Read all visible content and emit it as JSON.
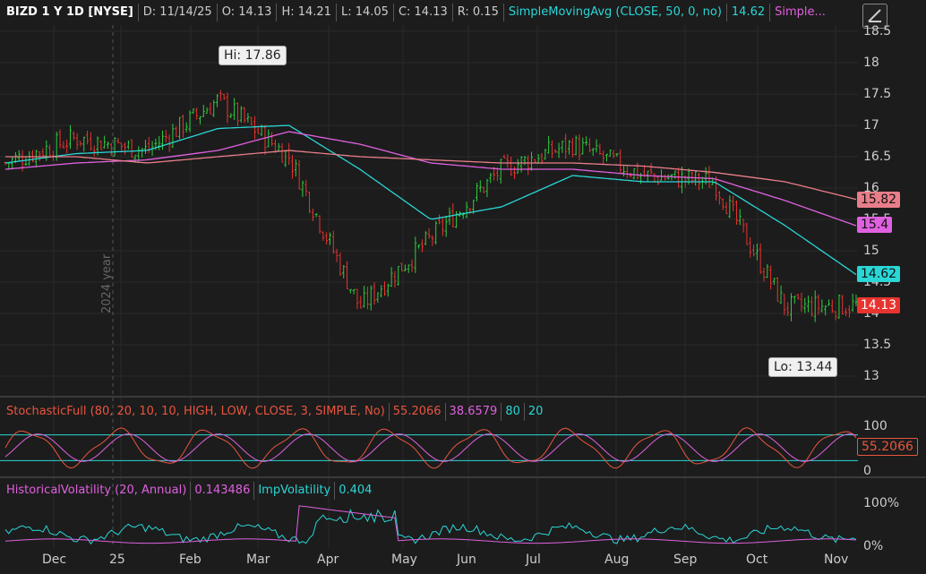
{
  "header": {
    "symbol": "BIZD 1 Y 1D [NYSE]",
    "date": "D: 11/14/25",
    "open": "O: 14.13",
    "high": "H: 14.21",
    "low": "L: 14.05",
    "close": "C: 14.13",
    "range": "R: 0.15",
    "sma50": "SimpleMovingAvg (CLOSE, 50, 0, no)",
    "sma50_value": "14.62",
    "sma_more": "Simple..."
  },
  "price_axis": {
    "ticks": [
      "18.5",
      "18",
      "17.5",
      "17",
      "16.5",
      "16",
      "15.5",
      "15",
      "14.5",
      "14",
      "13.5",
      "13"
    ],
    "badges": {
      "sma200": "15.82",
      "sma100": "15.4",
      "sma50": "14.62",
      "last": "14.13"
    }
  },
  "callouts": {
    "hi": "Hi: 17.86",
    "lo": "Lo: 13.44"
  },
  "year_label": "2024 year",
  "stochastic": {
    "title": "StochasticFull (80, 20, 10, 10, HIGH, LOW, CLOSE, 3, SIMPLE, No)",
    "k": "55.2066",
    "d": "38.6579",
    "ob": "80",
    "os": "20",
    "tick_top": "100",
    "tick_bottom": "0",
    "badge": "55.2066"
  },
  "volatility": {
    "title": "HistoricalVolatility (20, Annual)",
    "hv": "0.143486",
    "iv_title": "ImpVolatility",
    "iv": "0.404",
    "tick_top": "100%",
    "tick_bottom": "0%"
  },
  "months": [
    "Dec",
    "25",
    "Feb",
    "Mar",
    "Apr",
    "May",
    "Jun",
    "Jul",
    "Aug",
    "Sep",
    "Oct",
    "Nov"
  ],
  "colors": {
    "up": "#2ecc40",
    "down": "#e8332f",
    "sma50": "#2ad6d6",
    "sma100": "#e061e0",
    "sma200": "#e87e8a",
    "stoch_k": "#e8553f",
    "stoch_d": "#e061e0",
    "background": "#1c1c1c"
  },
  "chart_data": {
    "type": "line",
    "ylim": [
      12.8,
      18.7
    ],
    "x": [
      "Nov",
      "Dec",
      "Jan",
      "Feb",
      "Mar",
      "Apr",
      "May",
      "Jun",
      "Jul",
      "Aug",
      "Sep",
      "Oct",
      "Nov"
    ],
    "series": [
      {
        "values": [
          16.4,
          16.8,
          16.6,
          17.4,
          16.5,
          14.1,
          15.2,
          16.3,
          16.7,
          16.2,
          16.1,
          14.1,
          14.13
        ]
      },
      {
        "values": [
          16.4,
          16.55,
          16.6,
          16.95,
          17.0,
          16.3,
          15.5,
          15.7,
          16.2,
          16.1,
          16.1,
          15.4,
          14.62
        ]
      },
      {
        "values": [
          16.3,
          16.4,
          16.45,
          16.6,
          16.9,
          16.7,
          16.4,
          16.3,
          16.3,
          16.2,
          16.15,
          15.8,
          15.4
        ]
      },
      {
        "values": [
          16.5,
          16.5,
          16.4,
          16.5,
          16.6,
          16.5,
          16.45,
          16.4,
          16.4,
          16.35,
          16.25,
          16.1,
          15.82
        ]
      }
    ]
  }
}
